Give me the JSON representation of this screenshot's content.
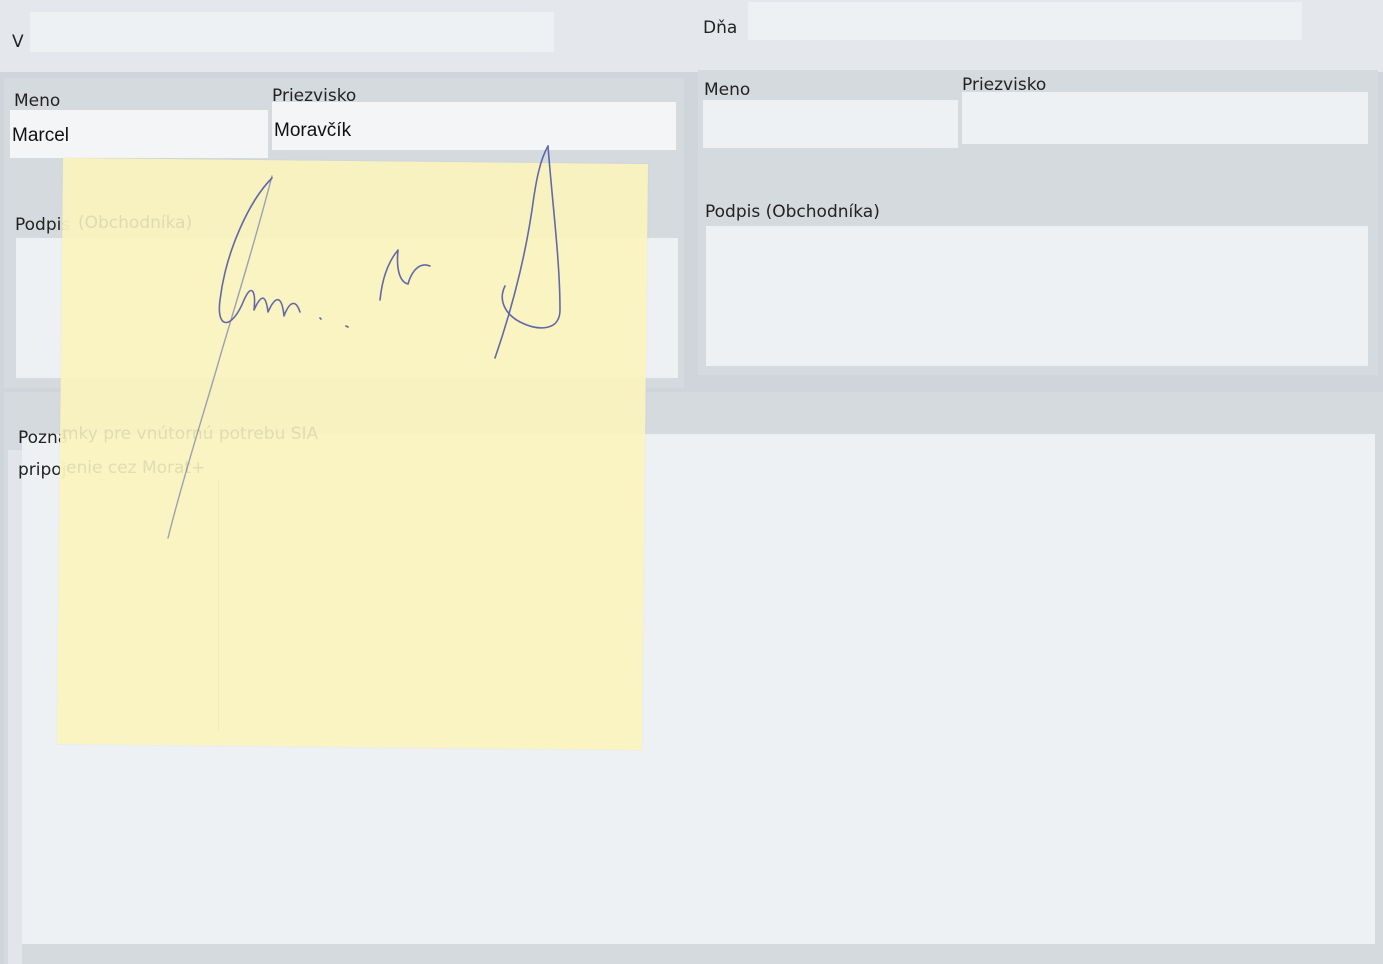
{
  "top": {
    "v_label": "V",
    "dna_label": "Dňa"
  },
  "left_person": {
    "meno_label": "Meno",
    "meno_value": "Marcel",
    "priezvisko_label": "Priezvisko",
    "priezvisko_value": "Moravčík",
    "podpis_label": "Podpis",
    "podpis_label_rest": "(Obchodníka)"
  },
  "right_person": {
    "meno_label": "Meno",
    "meno_value": "",
    "priezvisko_label": "Priezvisko",
    "priezvisko_value": "",
    "podpis_label": "Podpis (Obchodníka)"
  },
  "notes": {
    "label_visible": "Pozná",
    "label_hidden": "mky pre vnútornú potrebu SIA",
    "text_visible": "pripoj",
    "text_hidden": "enie cez Morat+"
  },
  "colors": {
    "paper": "#cfd5da",
    "field": "#eef1f4",
    "sticky_note": "#f9f3be",
    "signature_ink": "#4a4fa3"
  }
}
